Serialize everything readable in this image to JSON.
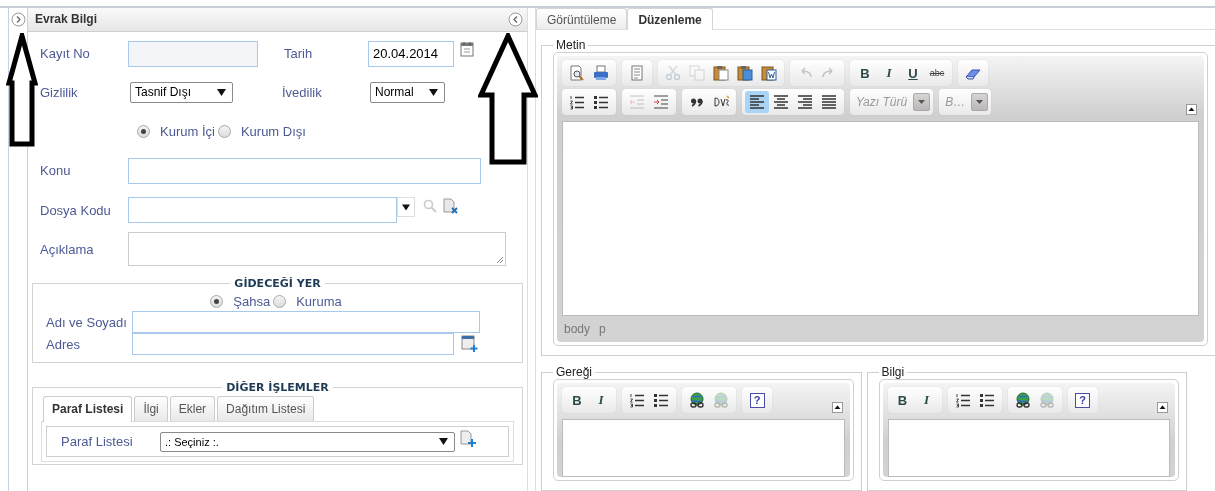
{
  "evrak_bilgi": {
    "title": "Evrak Bilgi",
    "kayit_no": {
      "label": "Kayıt No"
    },
    "tarih": {
      "label": "Tarih",
      "value": "20.04.2014"
    },
    "gizlilik": {
      "label": "Gizlilik",
      "value": "Tasnif Dışı"
    },
    "ivedilik": {
      "label": "İvedilik",
      "value": "Normal"
    },
    "scope_radios": [
      {
        "label": "Kurum İçi",
        "selected": true
      },
      {
        "label": "Kurum Dışı",
        "selected": false
      }
    ],
    "konu": {
      "label": "Konu"
    },
    "dosya_kodu": {
      "label": "Dosya Kodu"
    },
    "aciklama": {
      "label": "Açıklama"
    }
  },
  "gidecegi_yer": {
    "title": "GİDECEĞİ YER",
    "radios": [
      {
        "label": "Şahsa",
        "selected": true
      },
      {
        "label": "Kuruma",
        "selected": false
      }
    ],
    "fields": [
      {
        "label": "Adı ve Soyadı"
      },
      {
        "label": "Adres"
      }
    ]
  },
  "diger_islemler": {
    "title": "DİĞER İŞLEMLER",
    "tabs": [
      {
        "label": "Paraf Listesi",
        "selected": true
      },
      {
        "label": "İlgi",
        "selected": false
      },
      {
        "label": "Ekler",
        "selected": false
      },
      {
        "label": "Dağıtım Listesi",
        "selected": false
      }
    ],
    "field": {
      "label": "Paraf Listesi",
      "value": ".: Seçiniz :."
    }
  },
  "editor_pane": {
    "tabs": [
      {
        "label": "Görüntüleme",
        "selected": false
      },
      {
        "label": "Düzenleme",
        "selected": true
      }
    ],
    "editors": [
      {
        "title": "Metin",
        "toolbar": [
          [
            [
              {
                "kind": "preview",
                "disabled": false
              },
              {
                "kind": "print",
                "disabled": false
              }
            ],
            [
              {
                "kind": "templates",
                "disabled": false
              }
            ],
            [
              {
                "kind": "cut",
                "disabled": true
              },
              {
                "kind": "copy",
                "disabled": true
              },
              {
                "kind": "paste",
                "disabled": false
              },
              {
                "kind": "paste-text",
                "disabled": false
              },
              {
                "kind": "paste-word",
                "disabled": false
              }
            ],
            [
              {
                "kind": "undo",
                "disabled": true
              },
              {
                "kind": "redo",
                "disabled": true
              }
            ],
            [
              {
                "kind": "bold",
                "label": "B",
                "disabled": false
              },
              {
                "kind": "italic",
                "label": "I",
                "disabled": false
              },
              {
                "kind": "underline",
                "label": "U",
                "disabled": false
              },
              {
                "kind": "strike",
                "label": "abc",
                "disabled": false
              }
            ],
            [
              {
                "kind": "eraser",
                "disabled": false
              }
            ]
          ],
          [
            [
              {
                "kind": "ordered-list",
                "disabled": false
              },
              {
                "kind": "bullet-list",
                "disabled": false
              }
            ],
            [
              {
                "kind": "outdent",
                "disabled": true
              },
              {
                "kind": "indent",
                "disabled": false
              }
            ],
            [
              {
                "kind": "quote",
                "disabled": false
              },
              {
                "kind": "div",
                "disabled": false
              }
            ],
            [
              {
                "kind": "align-left",
                "disabled": false,
                "active": true
              },
              {
                "kind": "align-center",
                "disabled": false,
                "active": false
              },
              {
                "kind": "align-right",
                "disabled": false,
                "active": false
              },
              {
                "kind": "justify",
                "disabled": false,
                "active": false
              }
            ],
            [
              {
                "kind": "combo",
                "label": "Yazı Türü",
                "disabled": false
              }
            ],
            [
              {
                "kind": "combo",
                "label": "B…",
                "disabled": false
              }
            ]
          ]
        ],
        "status_path": [
          "body",
          "p"
        ]
      },
      {
        "title": "Gereği",
        "toolbar": [
          [
            [
              {
                "kind": "bold",
                "label": "B",
                "disabled": false
              },
              {
                "kind": "italic",
                "label": "I",
                "disabled": false
              }
            ],
            [
              {
                "kind": "ordered-list",
                "disabled": false
              },
              {
                "kind": "bullet-list",
                "disabled": false
              }
            ],
            [
              {
                "kind": "link",
                "disabled": false
              },
              {
                "kind": "unlink",
                "disabled": true
              }
            ],
            [
              {
                "kind": "help",
                "label": "?",
                "disabled": false
              }
            ]
          ]
        ]
      },
      {
        "title": "Bilgi",
        "toolbar": [
          [
            [
              {
                "kind": "bold",
                "label": "B",
                "disabled": false
              },
              {
                "kind": "italic",
                "label": "I",
                "disabled": false
              }
            ],
            [
              {
                "kind": "ordered-list",
                "disabled": false
              },
              {
                "kind": "bullet-list",
                "disabled": false
              }
            ],
            [
              {
                "kind": "link",
                "disabled": false
              },
              {
                "kind": "unlink",
                "disabled": true
              }
            ],
            [
              {
                "kind": "help",
                "label": "?",
                "disabled": false
              }
            ]
          ]
        ]
      }
    ]
  },
  "annotations": [
    {
      "kind": "up-arrow"
    },
    {
      "kind": "up-arrow"
    }
  ]
}
